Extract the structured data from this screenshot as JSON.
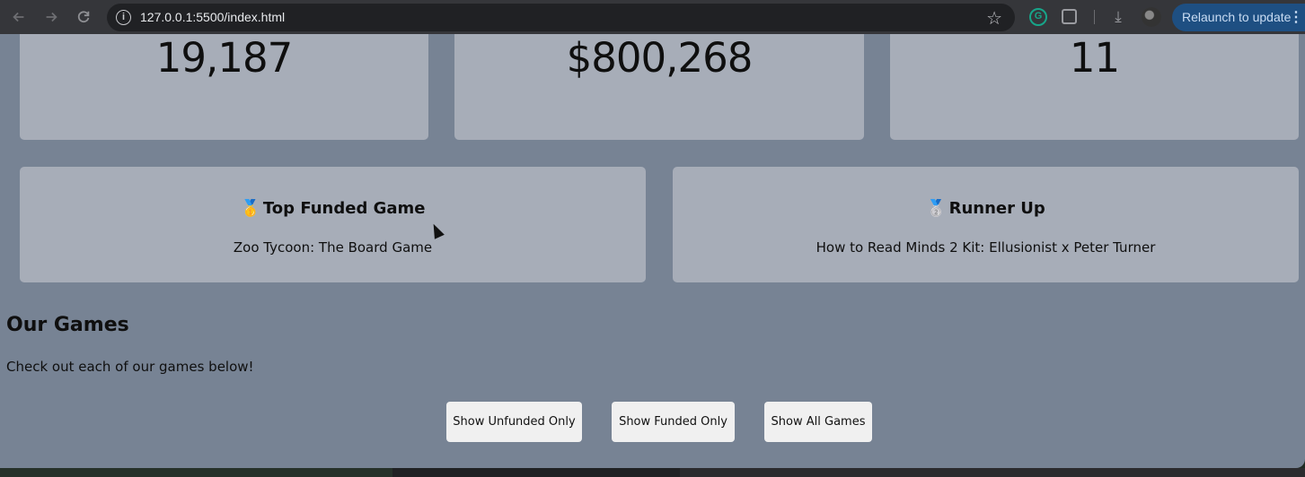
{
  "browser": {
    "url": "127.0.0.1:5500/index.html",
    "relaunch_label": "Relaunch to update",
    "extension_letter": "G"
  },
  "stats": [
    {
      "value": "19,187"
    },
    {
      "value": "$800,268"
    },
    {
      "value": "11"
    }
  ],
  "featured": {
    "top": {
      "medal": "🥇",
      "title": "Top Funded Game",
      "name": "Zoo Tycoon: The Board Game"
    },
    "runner": {
      "medal": "🥈",
      "title": "Runner Up",
      "name": "How to Read Minds 2 Kit: Ellusionist x Peter Turner"
    }
  },
  "games_section": {
    "title": "Our Games",
    "subtitle": "Check out each of our games below!"
  },
  "filters": {
    "unfunded": "Show Unfunded Only",
    "funded": "Show Funded Only",
    "all": "Show All Games"
  },
  "colors": {
    "page_bg": "#778394",
    "card_bg": "#a7adb8",
    "button_bg": "#f0f0f0",
    "relaunch_bg": "#1e4f82"
  }
}
